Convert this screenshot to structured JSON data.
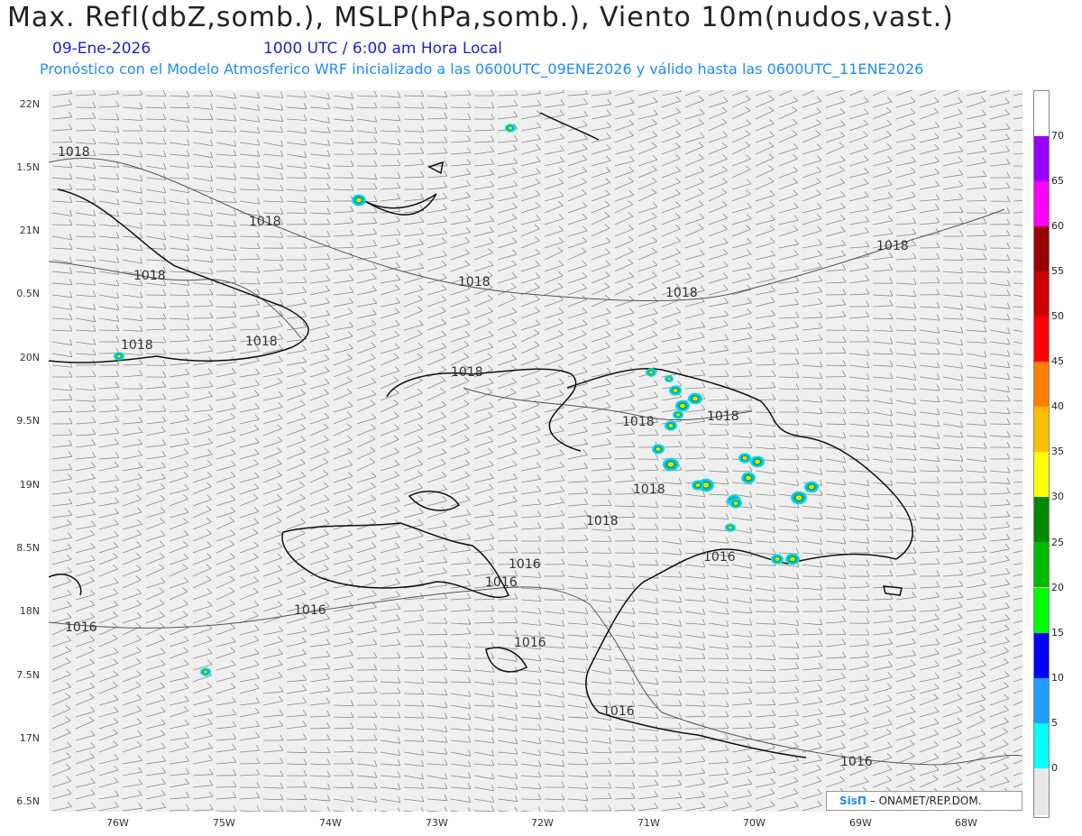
{
  "header": {
    "title": "Max. Refl(dbZ,somb.), MSLP(hPa,somb.), Viento 10m(nudos,vast.)",
    "date": "09-Ene-2026",
    "time": "1000 UTC / 6:00 am Hora Local",
    "model_info": "Pronóstico con el Modelo Atmosferico WRF inicializado a las 0600UTC_09ENE2026 y válido hasta las  0600UTC_11ENE2026"
  },
  "axes": {
    "y_labels": [
      "22N",
      "1.5N",
      "21N",
      "0.5N",
      "20N",
      "9.5N",
      "19N",
      "8.5N",
      "18N",
      "7.5N",
      "17N",
      "6.5N"
    ],
    "x_labels": [
      "76W",
      "75W",
      "74W",
      "73W",
      "72W",
      "71W",
      "70W",
      "69W",
      "68W"
    ]
  },
  "isobar_labels": [
    "1018",
    "1018",
    "1018",
    "1018",
    "1018",
    "1018",
    "1018",
    "1018",
    "1018",
    "1018",
    "1018",
    "1018",
    "1018",
    "1016",
    "1016",
    "1016",
    "1016",
    "1016",
    "1016"
  ],
  "colorbar": {
    "labels": [
      "70",
      "65",
      "60",
      "55",
      "50",
      "45",
      "40",
      "35",
      "30",
      "25",
      "20",
      "15",
      "10",
      "5",
      "0"
    ],
    "colors": [
      "#ffffff",
      "#9900ff",
      "#ff00ff",
      "#990000",
      "#cc0000",
      "#ff0000",
      "#ff7f00",
      "#ffbf00",
      "#ffff00",
      "#008800",
      "#00bb00",
      "#00ff00",
      "#0000ff",
      "#1f9fff",
      "#00ffff",
      "#e8e8e8"
    ]
  },
  "credit": {
    "brand": "SisΠ",
    "text": "– ONAMET/REP.DOM."
  },
  "colors": {
    "background": "#efefef",
    "coast": "#111111",
    "barbs": "#8a8a8a",
    "title_blue": "#1f1fd0",
    "subtitle_blue": "#1a8cff"
  }
}
